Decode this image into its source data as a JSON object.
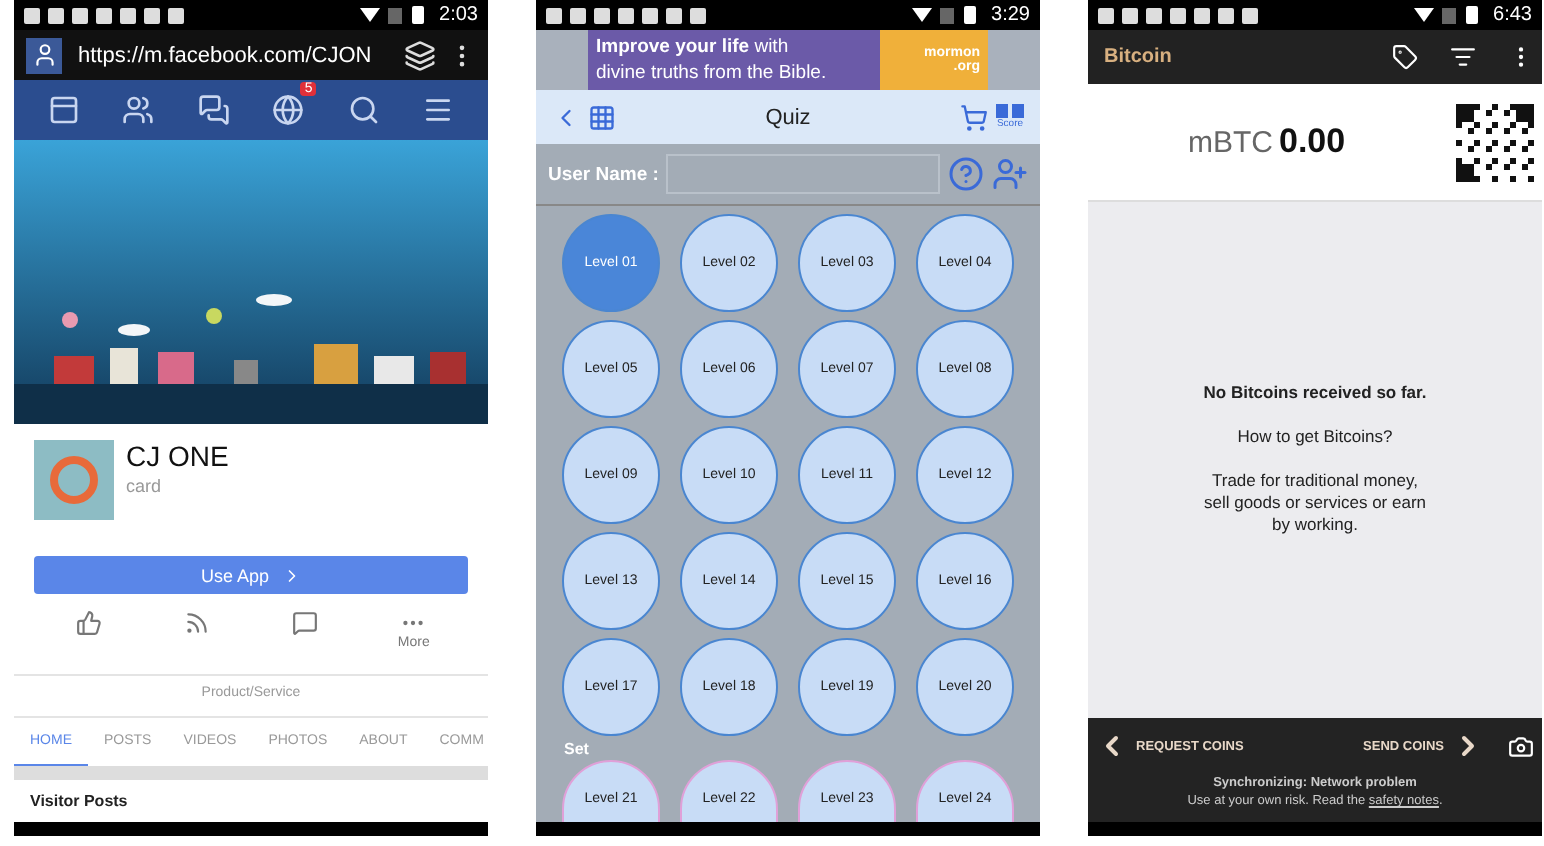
{
  "facebook_page": {
    "status_time": "2:03",
    "url": "https://m.facebook.com/CJON",
    "nav_icons": [
      {
        "kind": "feed"
      },
      {
        "kind": "friends"
      },
      {
        "kind": "messages"
      },
      {
        "kind": "notifications",
        "badge": "5"
      },
      {
        "kind": "search"
      },
      {
        "kind": "menu"
      }
    ],
    "profile": {
      "name": "CJ ONE",
      "category": "card"
    },
    "use_app_button": "Use App",
    "actions": [
      {
        "kind": "like"
      },
      {
        "kind": "follow"
      },
      {
        "kind": "message"
      },
      {
        "kind": "more",
        "label": "More"
      }
    ],
    "page_type": "Product/Service",
    "tabs": [
      {
        "label": "HOME",
        "selected": true
      },
      {
        "label": "POSTS",
        "selected": false
      },
      {
        "label": "VIDEOS",
        "selected": false
      },
      {
        "label": "PHOTOS",
        "selected": false
      },
      {
        "label": "ABOUT",
        "selected": false
      },
      {
        "label": "COMM",
        "selected": false
      }
    ],
    "section_title": "Visitor Posts"
  },
  "quiz_app": {
    "status_time": "3:29",
    "ad": {
      "headline": "**Improve your life** with",
      "subline": "divine truths from the Bible.",
      "brand": "mormon",
      "brand_domain": ".org"
    },
    "title": "Quiz",
    "score_label": "Score",
    "user_name_label": "User Name :",
    "levels": [
      {
        "label": "Level 01",
        "selected": true
      },
      {
        "label": "Level 02",
        "selected": false
      },
      {
        "label": "Level 03",
        "selected": false
      },
      {
        "label": "Level 04",
        "selected": false
      },
      {
        "label": "Level 05",
        "selected": false
      },
      {
        "label": "Level 06",
        "selected": false
      },
      {
        "label": "Level 07",
        "selected": false
      },
      {
        "label": "Level 08",
        "selected": false
      },
      {
        "label": "Level 09",
        "selected": false
      },
      {
        "label": "Level 10",
        "selected": false
      },
      {
        "label": "Level 11",
        "selected": false
      },
      {
        "label": "Level 12",
        "selected": false
      },
      {
        "label": "Level 13",
        "selected": false
      },
      {
        "label": "Level 14",
        "selected": false
      },
      {
        "label": "Level 15",
        "selected": false
      },
      {
        "label": "Level 16",
        "selected": false
      },
      {
        "label": "Level 17",
        "selected": false
      },
      {
        "label": "Level 18",
        "selected": false
      },
      {
        "label": "Level 19",
        "selected": false
      },
      {
        "label": "Level 20",
        "selected": false
      }
    ],
    "set_label": "Set",
    "set_levels": [
      {
        "label": "Level 21"
      },
      {
        "label": "Level 22"
      },
      {
        "label": "Level 23"
      },
      {
        "label": "Level 24"
      }
    ]
  },
  "bitcoin_wallet": {
    "status_time": "6:43",
    "title": "Bitcoin",
    "currency": "mBTC",
    "balance": "0.00",
    "empty_title": "No Bitcoins received so far.",
    "help_title": "How to get Bitcoins?",
    "help_text": "Trade for traditional money, sell goods or services or earn by working.",
    "request_button": "REQUEST COINS",
    "send_button": "SEND COINS",
    "sync_status": "Synchronizing: Network problem",
    "risk_text": "Use at your own risk. Read the",
    "risk_link": "safety notes",
    "risk_end": "."
  }
}
